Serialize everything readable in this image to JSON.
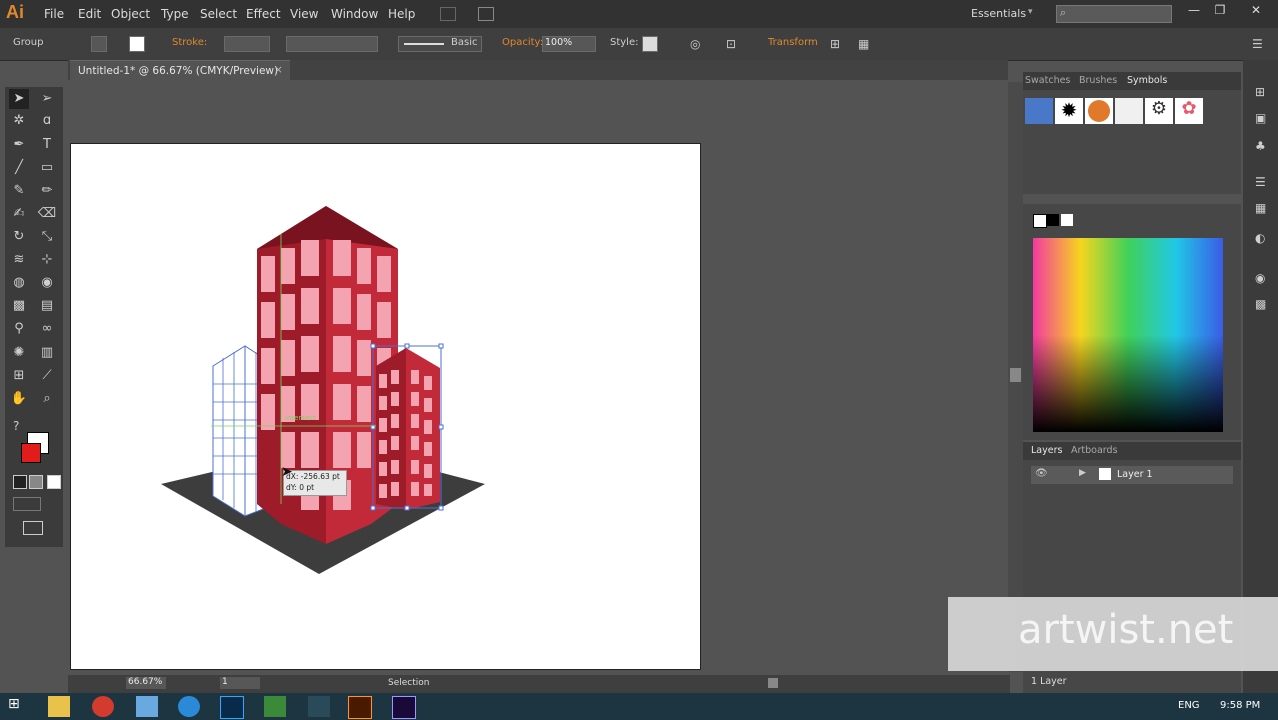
{
  "app": {
    "logo": "Ai",
    "menus": [
      "File",
      "Edit",
      "Object",
      "Type",
      "Select",
      "Effect",
      "View",
      "Window",
      "Help"
    ],
    "workspace": "Essentials"
  },
  "control": {
    "selection": "Group",
    "stroke_label": "Stroke:",
    "brush": "Basic",
    "opacity_label": "Opacity:",
    "opacity_value": "100%",
    "style_label": "Style:",
    "transform": "Transform"
  },
  "document": {
    "tab_title": "Untitled-1* @ 66.67% (CMYK/Preview)"
  },
  "canvas": {
    "tooltip_dx": "dX: -256.63 pt",
    "tooltip_dy": "dY: 0 pt",
    "smart_guide": "intersect"
  },
  "status": {
    "zoom": "66.67%",
    "page": "1",
    "tool_name": "Selection"
  },
  "panels": {
    "top_tabs": [
      "Swatches",
      "Brushes",
      "Symbols"
    ],
    "layers_tabs": [
      "Layers",
      "Artboards"
    ],
    "layer_name": "Layer 1",
    "layer_count": "1 Layer"
  },
  "taskbar": {
    "lang": "ENG",
    "time": "9:58 PM"
  },
  "watermark": "artwist.net",
  "colors": {
    "accent": "#e0882e",
    "building": "#f4a3b0",
    "building_dark": "#9e1b2a",
    "selection": "#4c6fd6"
  }
}
